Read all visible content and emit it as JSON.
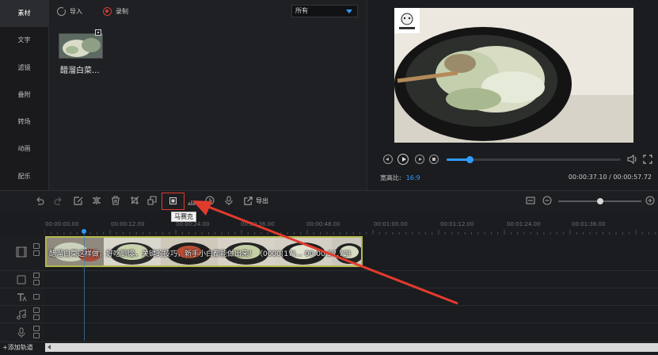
{
  "sidebar": {
    "items": [
      "素材",
      "文字",
      "滤镜",
      "叠附",
      "转场",
      "动画",
      "配乐"
    ]
  },
  "media_panel": {
    "import_label": "导入",
    "record_label": "录制",
    "filter_value": "所有",
    "clip_name": "醋溜白菜..."
  },
  "preview": {
    "aspect_label": "宽高比:",
    "aspect_value": "16:9",
    "timecode": "00:00:37.10 / 00:00:57.72",
    "progress_fraction": 0.13
  },
  "edit_toolbar": {
    "export_label": "导出",
    "tooltip": "马赛克",
    "zoom_fraction": 0.5
  },
  "ruler": {
    "labels": [
      "00:00:00.00",
      "00:00:12.00",
      "00:00:24.00",
      "00:00:36.00",
      "00:00:48.00",
      "00:01:00.00",
      "00:01:12.00",
      "00:01:24.00",
      "00:01:36.00"
    ]
  },
  "timeline": {
    "clip_caption": "醋溜白菜这样做，好吃到爆，关键的技巧，新手小白都能做出来！（0000(17)... 00:00:57.72）",
    "add_track_label": "+添加轨道"
  },
  "colors": {
    "accent": "#2f9bff",
    "highlight_red": "#e23b2e",
    "clip_border": "#b4b84b"
  }
}
